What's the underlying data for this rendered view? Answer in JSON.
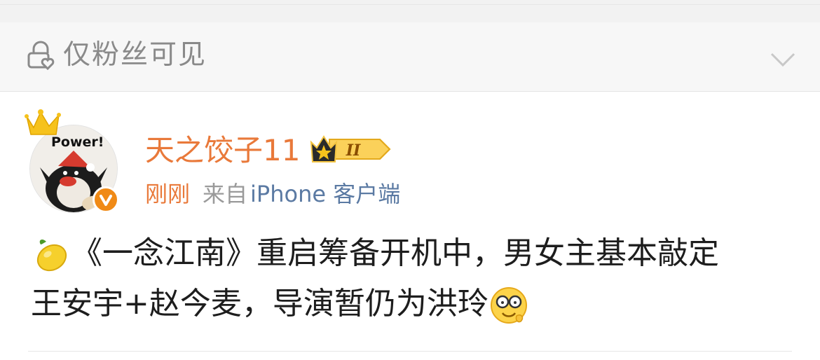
{
  "visibility": {
    "label": "仅粉丝可见",
    "icon": "lock-heart-icon",
    "expand_icon": "chevron-down-icon"
  },
  "post": {
    "author": {
      "name": "天之饺子11",
      "avatar_text": "Power!",
      "crown_icon": "crown-icon",
      "verified_icon": "verified-v-icon",
      "vip_level": "II"
    },
    "time": "刚刚",
    "source_prefix": "来自",
    "source_device": "iPhone 客户端",
    "body_line1": "《一念江南》重启筹备开机中，男女主基本敲定",
    "body_line2": "王安宇+赵今麦，导演暂仍为洪玲",
    "leading_emoji": "lemon-icon",
    "trailing_emoji": "face-glasses-icon"
  },
  "colors": {
    "accent_orange": "#e9793a",
    "link_blue": "#5b7aa3",
    "muted_gray": "#8a8a8a"
  }
}
